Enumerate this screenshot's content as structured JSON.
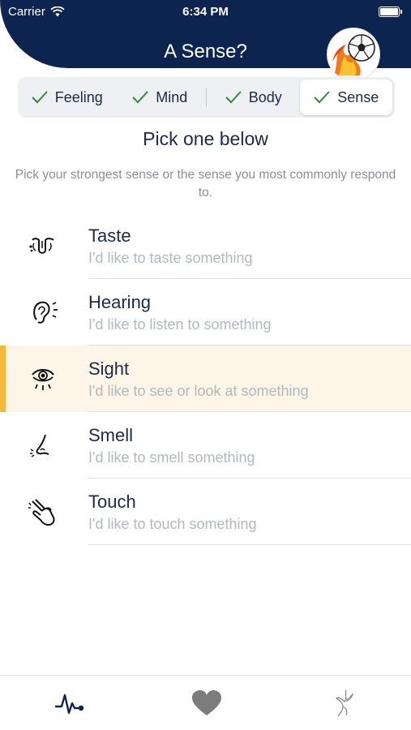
{
  "status_bar": {
    "carrier": "Carrier",
    "time": "6:34 PM"
  },
  "header": {
    "title": "A Sense?",
    "avatar_icon": "soccer-ball-flame-icon"
  },
  "segments": [
    {
      "label": "Feeling",
      "checked": true,
      "selected": false
    },
    {
      "label": "Mind",
      "checked": true,
      "selected": false
    },
    {
      "label": "Body",
      "checked": true,
      "selected": false
    },
    {
      "label": "Sense",
      "checked": true,
      "selected": true
    }
  ],
  "heading": "Pick one below",
  "description": "Pick your strongest sense or the sense you most commonly respond to.",
  "senses": [
    {
      "name": "Taste",
      "subtitle": "I'd like to taste something",
      "icon": "tongue-icon",
      "selected": false
    },
    {
      "name": "Hearing",
      "subtitle": "I'd like to listen to something",
      "icon": "ear-icon",
      "selected": false
    },
    {
      "name": "Sight",
      "subtitle": "I'd like to see or look at something",
      "icon": "eye-icon",
      "selected": true
    },
    {
      "name": "Smell",
      "subtitle": "I'd like to smell something",
      "icon": "nose-icon",
      "selected": false
    },
    {
      "name": "Touch",
      "subtitle": "I'd like to touch something",
      "icon": "hand-icon",
      "selected": false
    }
  ],
  "tabs": [
    {
      "icon": "heartbeat-icon",
      "selected": true
    },
    {
      "icon": "heart-icon",
      "selected": false
    },
    {
      "icon": "phoenix-icon",
      "selected": false
    }
  ],
  "colors": {
    "header": "#0d2451",
    "accent": "#f5b83d",
    "check": "#2e8a3e",
    "selected_row": "#fdf6e8"
  }
}
